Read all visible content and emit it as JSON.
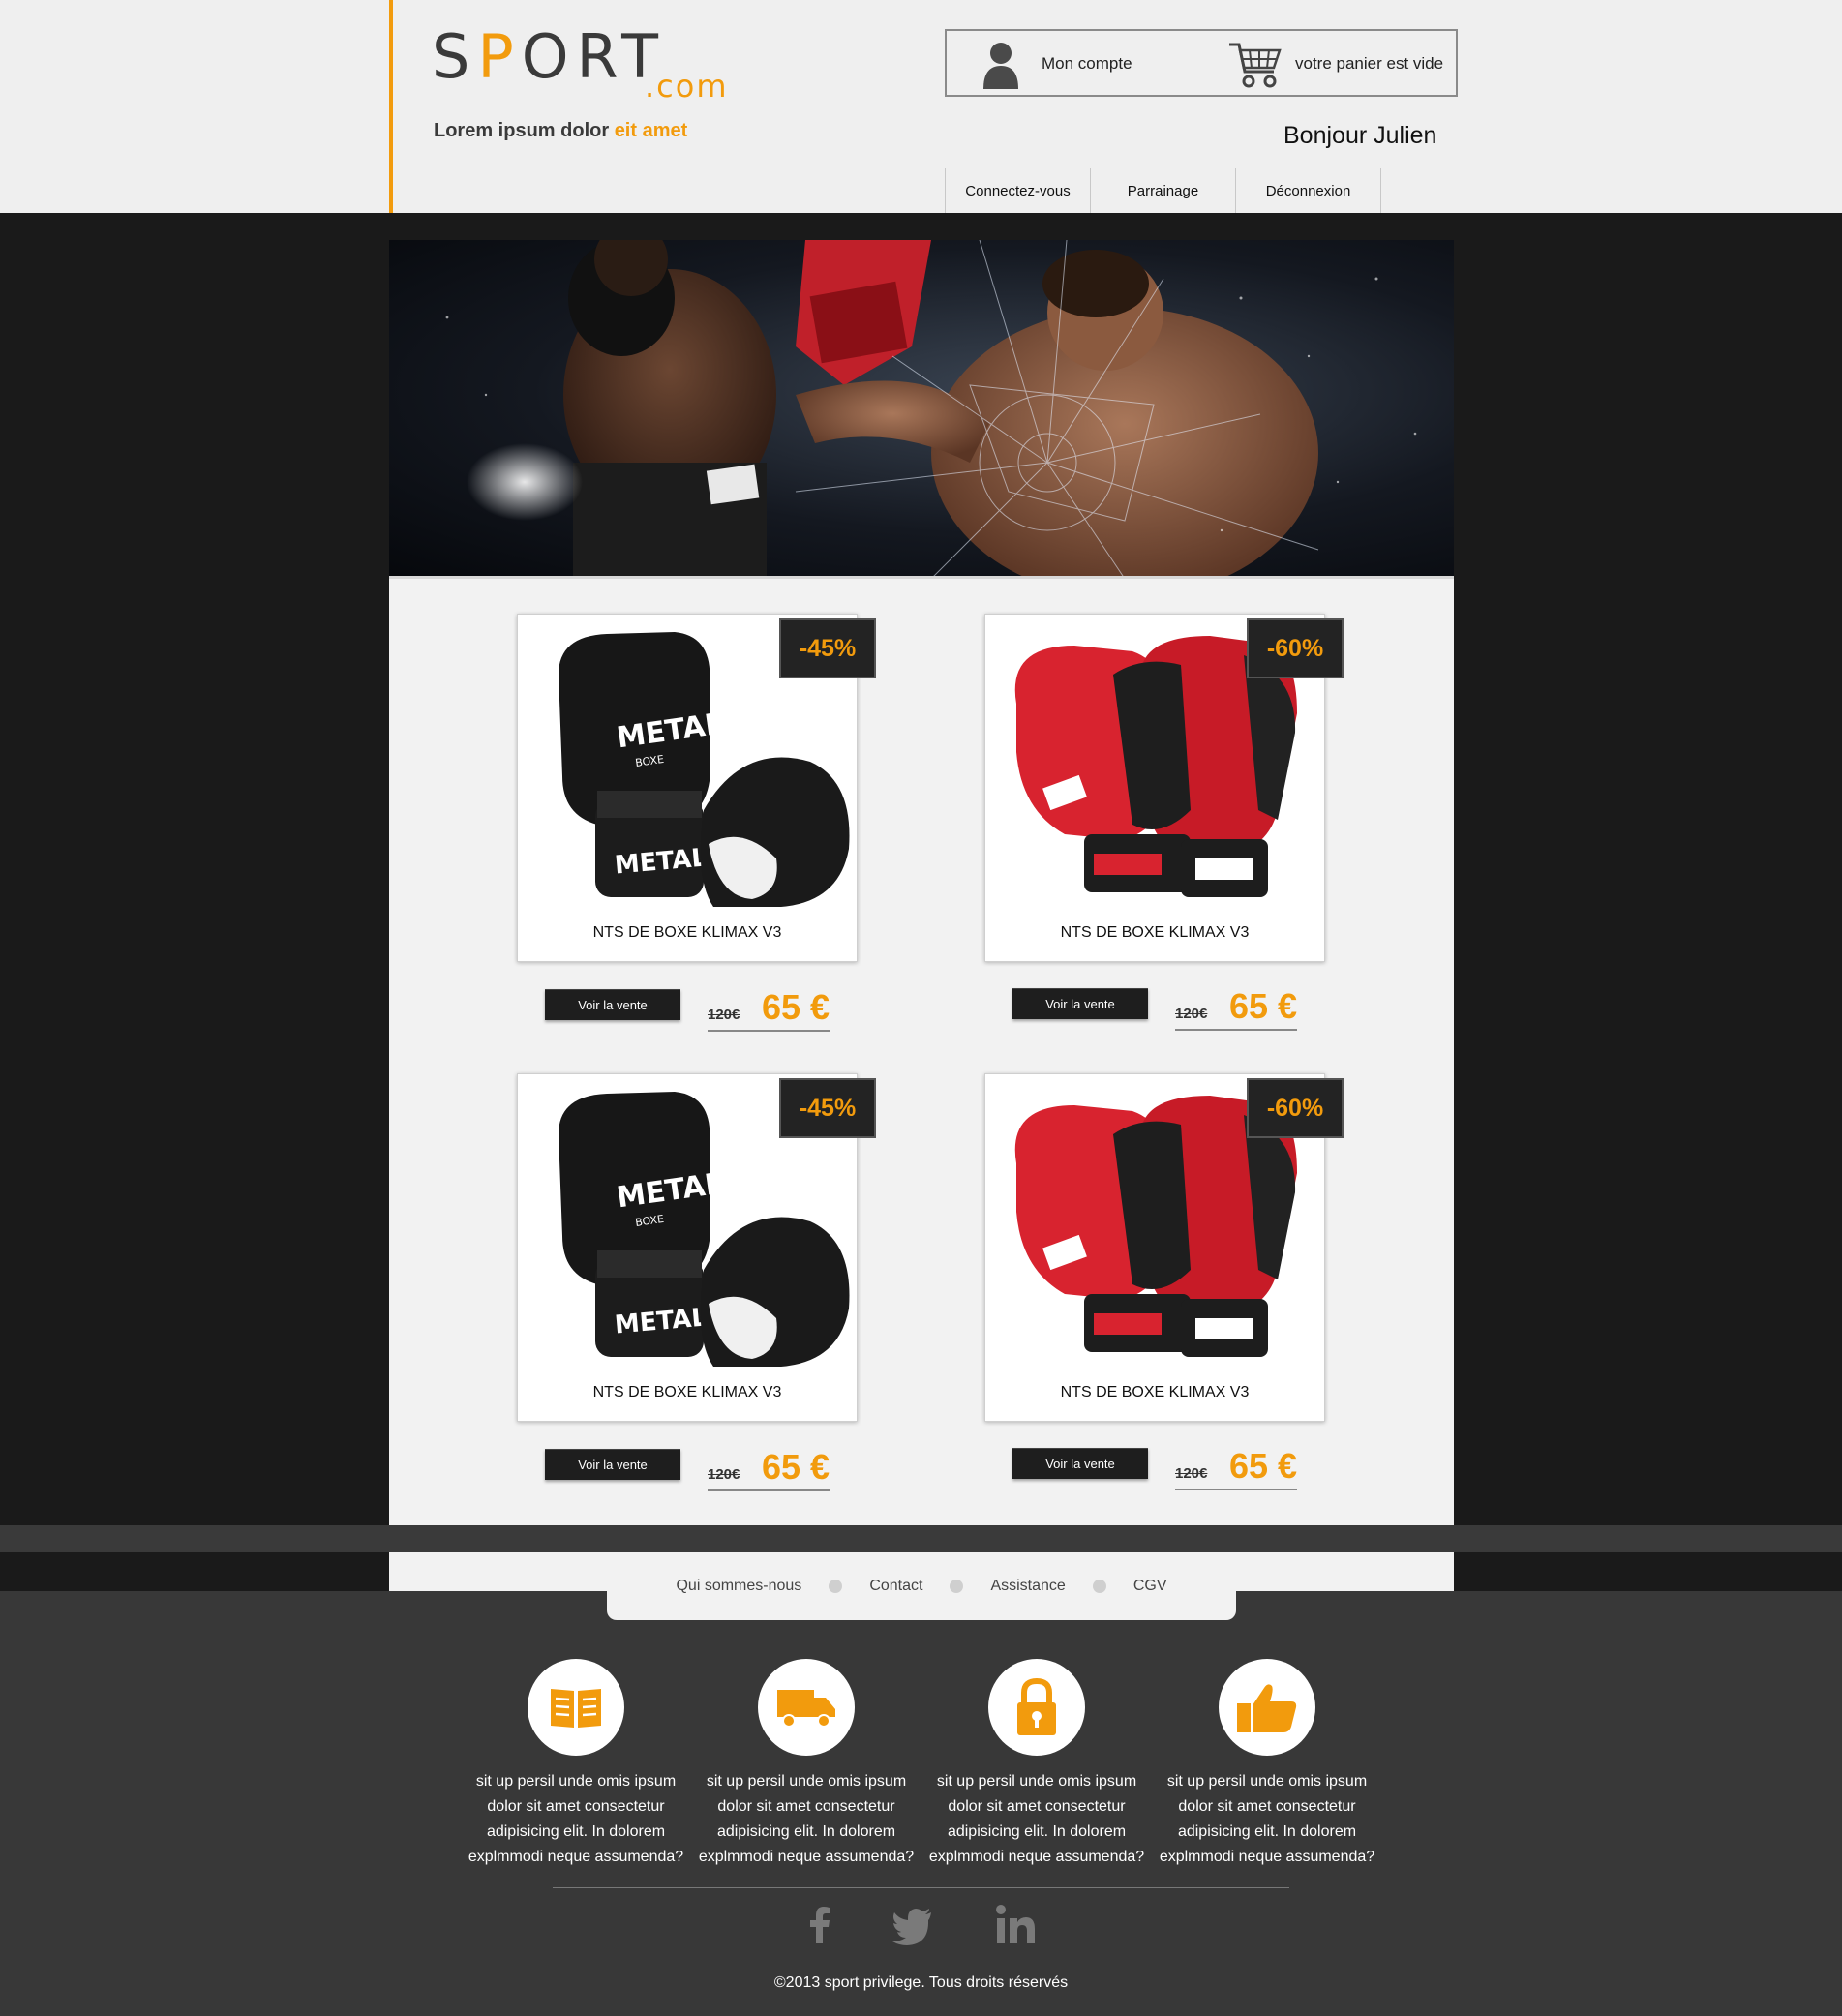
{
  "header": {
    "logo_main": "SPORT",
    "logo_sub": ".com",
    "tagline_start": "Lorem ipsum dolor ",
    "tagline_accent": "eit amet",
    "account_label": "Mon compte",
    "cart_label": "votre panier est vide",
    "greeting": "Bonjour Julien",
    "nav": [
      "Connectez-vous",
      "Parrainage",
      "Déconnexion"
    ]
  },
  "products": [
    {
      "name": "NTS DE BOXE KLIMAX V3",
      "discount": "-45%",
      "button": "Voir la vente",
      "old_price": "120€",
      "new_price": "65 €",
      "image": "black-gloves"
    },
    {
      "name": "NTS DE BOXE KLIMAX V3",
      "discount": "-60%",
      "button": "Voir la vente",
      "old_price": "120€",
      "new_price": "65 €",
      "image": "red-gloves"
    },
    {
      "name": "NTS DE BOXE KLIMAX V3",
      "discount": "-45%",
      "button": "Voir la vente",
      "old_price": "120€",
      "new_price": "65 €",
      "image": "black-gloves"
    },
    {
      "name": "NTS DE BOXE KLIMAX V3",
      "discount": "-60%",
      "button": "Voir la vente",
      "old_price": "120€",
      "new_price": "65 €",
      "image": "red-gloves"
    }
  ],
  "footer": {
    "links": [
      "Qui sommes-nous",
      "Contact",
      "Assistance",
      "CGV"
    ],
    "features": [
      {
        "icon": "book-icon",
        "text": "sit up persil unde omis ipsum dolor sit amet consectetur adipisicing elit. In dolorem explmmodi neque assumenda?"
      },
      {
        "icon": "truck-icon",
        "text": "sit up persil unde omis ipsum dolor sit amet consectetur adipisicing elit. In dolorem explmmodi neque assumenda?"
      },
      {
        "icon": "lock-icon",
        "text": "sit up persil unde omis ipsum dolor sit amet consectetur adipisicing elit. In dolorem explmmodi neque assumenda?"
      },
      {
        "icon": "thumbs-up-icon",
        "text": "sit up persil unde omis ipsum dolor sit amet consectetur adipisicing elit. In dolorem explmmodi neque assumenda?"
      }
    ],
    "social": [
      "facebook-icon",
      "twitter-icon",
      "linkedin-icon"
    ],
    "copyright": "©2013 sport privilege. Tous droits réservés"
  },
  "colors": {
    "accent": "#f29b0d",
    "dark": "#1a1a1a",
    "footer": "#383838"
  }
}
